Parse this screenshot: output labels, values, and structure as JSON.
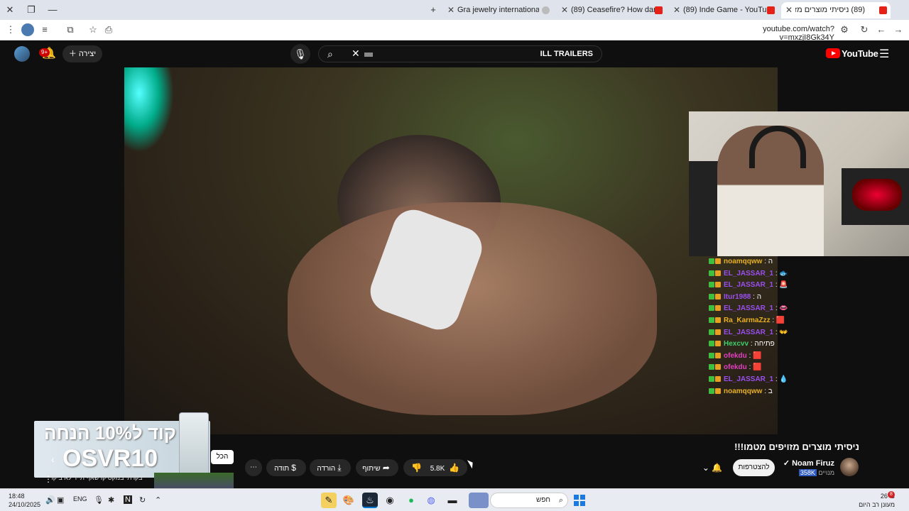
{
  "browser": {
    "tabs": [
      {
        "label": "(89) ניסיתי מוצרים מזויפים",
        "active": true
      },
      {
        "label": "(89) Inde Game - YouTube"
      },
      {
        "label": "(89) Ceasefire? How dare you!"
      },
      {
        "label": "Gra jewelry international autho"
      }
    ],
    "url": "youtube.com/watch?v=mxzjI8Gk34Y"
  },
  "yt": {
    "notif_count": "9+",
    "create_label": "יצירה",
    "search_query": "ILL TRAILERS",
    "logo_text": "YouTube"
  },
  "chat": [
    {
      "user": "noamqqww",
      "color": "#e8b020",
      "text": ": ה"
    },
    {
      "user": "EL_JASSAR_1",
      "color": "#9b4ef0",
      "text": ": 🐟"
    },
    {
      "user": "EL_JASSAR_1",
      "color": "#9b4ef0",
      "text": ": 🚨"
    },
    {
      "user": "Itur1988",
      "color": "#9b4ef0",
      "text": ": ה"
    },
    {
      "user": "EL_JASSAR_1",
      "color": "#9b4ef0",
      "text": ": 👄"
    },
    {
      "user": "Ra_KarmaZzz",
      "color": "#e8b020",
      "text": ": 🟥"
    },
    {
      "user": "EL_JASSAR_1",
      "color": "#9b4ef0",
      "text": ": 👐"
    },
    {
      "user": "Hexcvv",
      "color": "#3fd06a",
      "text": ": פתיחה"
    },
    {
      "user": "ofekdu",
      "color": "#e040c0",
      "text": ": 🟥"
    },
    {
      "user": "ofekdu",
      "color": "#e040c0",
      "text": ": 🟥"
    },
    {
      "user": "EL_JASSAR_1",
      "color": "#9b4ef0",
      "text": ": 💧"
    },
    {
      "user": "noamqqww",
      "color": "#e8b020",
      "text": ": ב"
    }
  ],
  "promo": {
    "line1": "קוד ל10% הנחה",
    "line2": "OSVR10",
    "all_chip": "הכל"
  },
  "recommended": {
    "title": "בקרתי במקסיקו שאף תייר לא ביקר"
  },
  "video": {
    "title": "ניסיתי מוצרים מזויפים מטמו!!!",
    "channel_name": "Noam Firuz",
    "subscribers_count": "358K",
    "subscribers_label": "מנויים",
    "subscribe_label": "להצטרפות",
    "like_count": "5.8K",
    "share_label": "שיתוף",
    "download_label": "הורדה",
    "thanks_label": "תודה"
  },
  "taskbar": {
    "time": "18:48",
    "date": "24/10/2025",
    "lang": "ENG",
    "search_placeholder": "חפש",
    "temperature": "26°C",
    "weather_text": "מעונן רב היום",
    "weather_badge": "8"
  }
}
